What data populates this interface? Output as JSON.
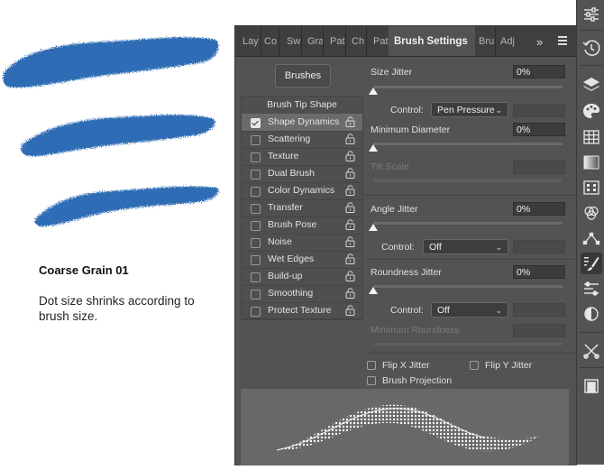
{
  "caption": {
    "title": "Coarse Grain 01",
    "description": "Dot size shrinks according to brush size."
  },
  "tabs": [
    {
      "label": "Lay"
    },
    {
      "label": "Co"
    },
    {
      "label": "Sw"
    },
    {
      "label": "Gra"
    },
    {
      "label": "Pat"
    },
    {
      "label": "Ch"
    },
    {
      "label": "Pat"
    },
    {
      "label": "Brush Settings",
      "active": true
    },
    {
      "label": "Bru"
    },
    {
      "label": "Adj"
    }
  ],
  "panel": {
    "more_label": "»",
    "brushes_button": "Brushes",
    "brush_tip_shape": "Brush Tip Shape",
    "options": [
      {
        "label": "Shape Dynamics",
        "checked": true
      },
      {
        "label": "Scattering",
        "checked": false
      },
      {
        "label": "Texture",
        "checked": false
      },
      {
        "label": "Dual Brush",
        "checked": false
      },
      {
        "label": "Color Dynamics",
        "checked": false
      },
      {
        "label": "Transfer",
        "checked": false
      },
      {
        "label": "Brush Pose",
        "checked": false
      },
      {
        "label": "Noise",
        "checked": false
      },
      {
        "label": "Wet Edges",
        "checked": false
      },
      {
        "label": "Build-up",
        "checked": false
      },
      {
        "label": "Smoothing",
        "checked": false
      },
      {
        "label": "Protect Texture",
        "checked": false
      }
    ],
    "size_jitter": {
      "label": "Size Jitter",
      "value": "0%"
    },
    "size_control": {
      "label": "Control:",
      "value": "Pen Pressure"
    },
    "minimum_diameter": {
      "label": "Minimum Diameter",
      "value": "0%"
    },
    "tilt_scale": {
      "label": "Tilt Scale"
    },
    "angle_jitter": {
      "label": "Angle Jitter",
      "value": "0%"
    },
    "angle_control": {
      "label": "Control:",
      "value": "Off"
    },
    "roundness_jitter": {
      "label": "Roundness Jitter",
      "value": "0%"
    },
    "roundness_control": {
      "label": "Control:",
      "value": "Off"
    },
    "minimum_roundness": {
      "label": "Minimum Roundness"
    },
    "flip_x": "Flip X Jitter",
    "flip_y": "Flip Y Jitter",
    "brush_projection": "Brush Projection"
  },
  "colors": {
    "stroke_blue": "#2f6db5",
    "panel_bg": "#535353",
    "tab_bar": "#3f3f3f"
  },
  "toolbar_icons": [
    "adjustments-sliders-icon",
    "history-icon",
    "layers-icon",
    "color-palette-icon",
    "swatches-grid-icon",
    "gradient-icon",
    "patterns-icon",
    "channels-icon",
    "paths-icon",
    "brush-settings-icon",
    "properties-icon",
    "adjustments-icon",
    "tools-preset-icon",
    "library-icon"
  ]
}
